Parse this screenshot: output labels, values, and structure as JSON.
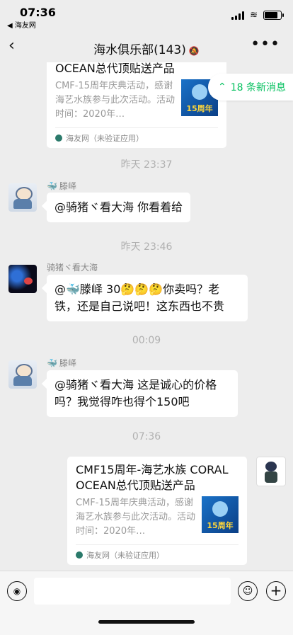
{
  "status": {
    "time": "07:36",
    "back_app": "◀ 海友网"
  },
  "nav": {
    "title": "海水俱乐部(143)"
  },
  "new_messages": {
    "label": "18 条新消息"
  },
  "card_top": {
    "title": "OCEAN总代顶贴送产品",
    "desc": "CMF-15周年庆典活动，感谢海艺水族参与此次活动。活动时间：2020年…",
    "thumb_label": "15周年",
    "source": "海友网（未验证应用）"
  },
  "messages": [
    {
      "time": "昨天 23:37",
      "sender": "滕峄",
      "text": "@骑猪ヾ看大海 你看着给"
    },
    {
      "time": "昨天 23:46",
      "sender": "骑猪ヾ看大海",
      "text": "@🐳滕峄 30🤔🤔🤔你卖吗？老铁，还是自己说吧！这东西也不贵"
    },
    {
      "time": "00:09",
      "sender": "滕峄",
      "text": "@骑猪ヾ看大海 这是诚心的价格吗？我觉得咋也得个150吧"
    },
    {
      "time": "07:36"
    }
  ],
  "card_bottom": {
    "title": "CMF15周年-海艺水族 CORAL OCEAN总代顶贴送产品",
    "desc": "CMF-15周年庆典活动，感谢海艺水族参与此次活动。活动时间：2020年…",
    "thumb_label": "15周年",
    "source": "海友网（未验证应用）"
  },
  "input": {
    "placeholder": ""
  }
}
